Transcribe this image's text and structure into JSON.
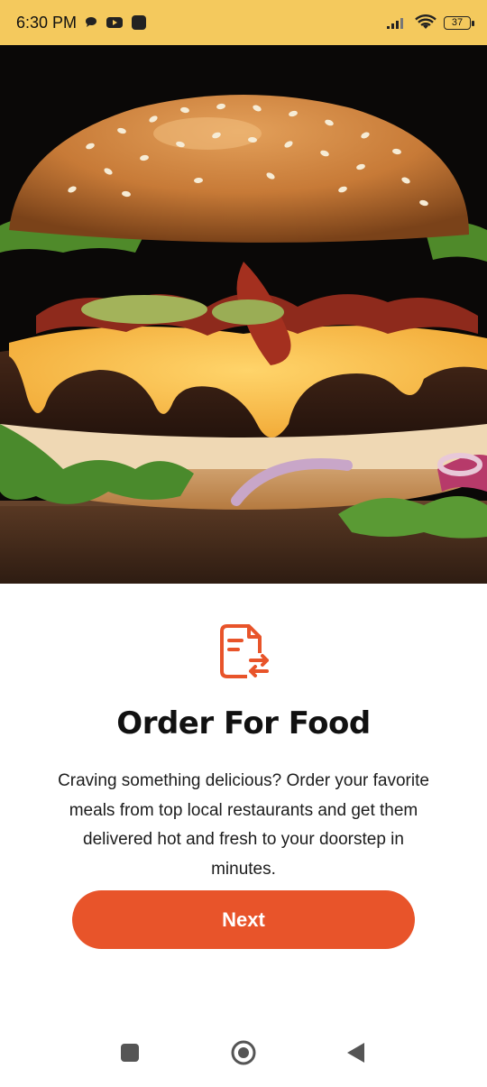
{
  "status_bar": {
    "time": "6:30 PM",
    "battery": "37",
    "icons": [
      "chat-bubble-icon",
      "youtube-icon",
      "app-square-icon",
      "signal-icon",
      "wifi-icon",
      "battery-icon"
    ]
  },
  "hero": {
    "image": "burger-photo"
  },
  "onboarding": {
    "icon": "order-document-icon",
    "title": "Order For Food",
    "description": "Craving something delicious? Order your favorite meals from top local restaurants and get them delivered hot and fresh to your doorstep in minutes.",
    "next_label": "Next"
  },
  "nav_bar": {
    "icons": [
      "recent-apps-icon",
      "home-icon",
      "back-icon"
    ]
  },
  "colors": {
    "status_bar": "#f4c95d",
    "accent": "#e8542a",
    "text": "#111111"
  }
}
